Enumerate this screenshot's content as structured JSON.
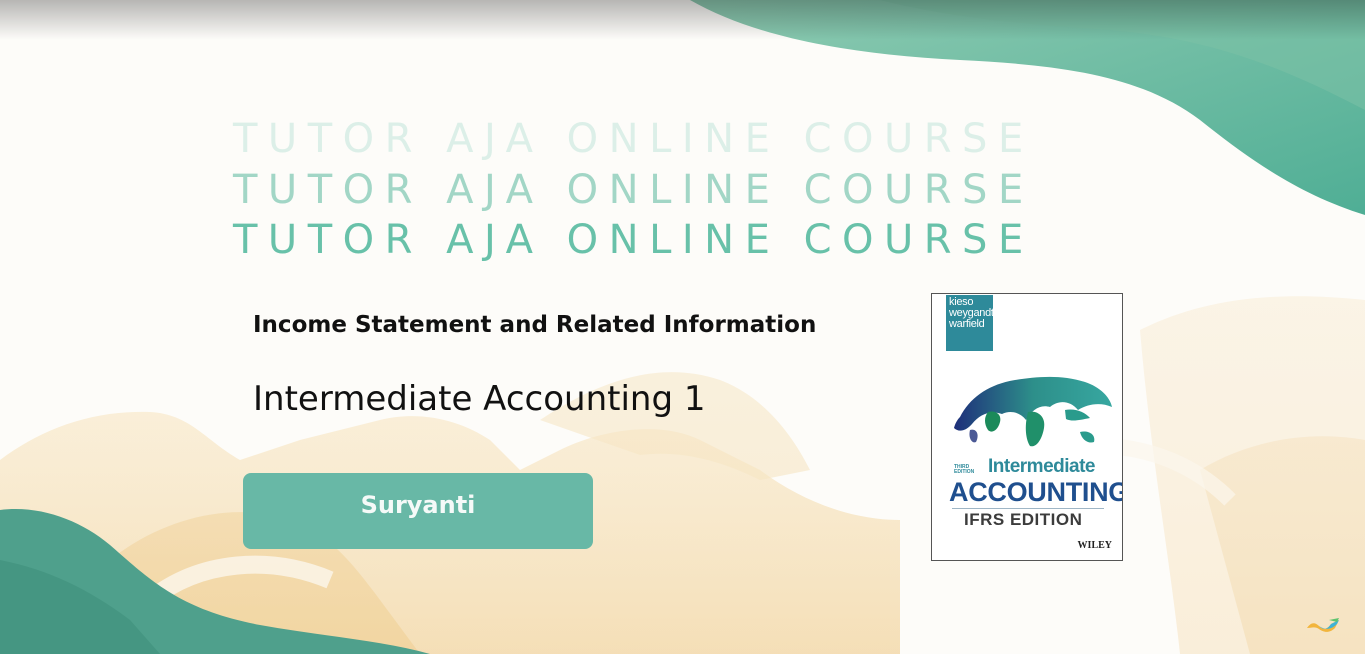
{
  "slide": {
    "title_lines": [
      "TUTOR AJA ONLINE COURSE",
      "TUTOR AJA ONLINE COURSE",
      "TUTOR AJA ONLINE COURSE"
    ],
    "subtitle": "Income Statement and Related Information",
    "course_name": "Intermediate Accounting 1",
    "presenter": "Suryanti"
  },
  "book_cover": {
    "authors": [
      "kieso",
      "weygandt",
      "warfield"
    ],
    "edition": "THIRD EDITION",
    "title_line1": "Intermediate",
    "title_line2": "ACCOUNTING",
    "subtitle": "IFRS EDITION",
    "publisher": "WILEY"
  },
  "colors": {
    "teal_accent": "#68b8a6",
    "title_light": "#dcefe8",
    "title_mid": "#a2d6c6",
    "title_dark": "#68c1a9",
    "sand": "#f3d9a8",
    "book_teal": "#2e8a9a",
    "book_navy": "#1f4f8e"
  },
  "icons": {
    "corner_logo": "colorful-wave-logo-icon",
    "globe": "world-map-icon"
  }
}
